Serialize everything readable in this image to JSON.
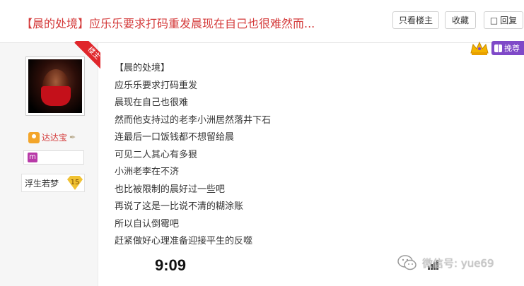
{
  "header": {
    "title": "【晨的处境】应乐乐要求打码重发晨现在自己也很难然而...",
    "buttons": {
      "only_author": "只看楼主",
      "favorite": "收藏",
      "reply": "回复"
    },
    "reply_icon": "speech-bubble-icon"
  },
  "user": {
    "ribbon": "楼主",
    "name": "达达宝",
    "name_icon": "vip-user-icon",
    "feather_icon": "feather-icon",
    "badge_icon": "m-badge-icon",
    "level_label": "浮生若梦",
    "level_value": "15"
  },
  "reward": {
    "label": "挽尊",
    "icon": "gift-icon",
    "crown_icon": "crown-icon"
  },
  "post": {
    "lines": [
      "【晨的处境】",
      "应乐乐要求打码重发",
      "晨现在自己也很难",
      "然而他支持过的老李小洲居然落井下石",
      "连最后一口饭钱都不想留给晨",
      "可见二人其心有多狠",
      "小洲老李在不济",
      "也比被限制的晨好过一些吧",
      "再说了这是一比说不清的糊涂账",
      "所以自认倒霉吧",
      "赶紧做好心理准备迎接平生的反噬"
    ]
  },
  "overlay": {
    "time": "9:09",
    "watermark": "微信号: yue69",
    "watermark_icon": "wechat-icon",
    "signal_icon": "signal-bars-icon"
  },
  "colors": {
    "title": "#d43a3a",
    "ribbon": "#e0262b",
    "reward": "#7f49c8",
    "level": "#f1c232"
  }
}
